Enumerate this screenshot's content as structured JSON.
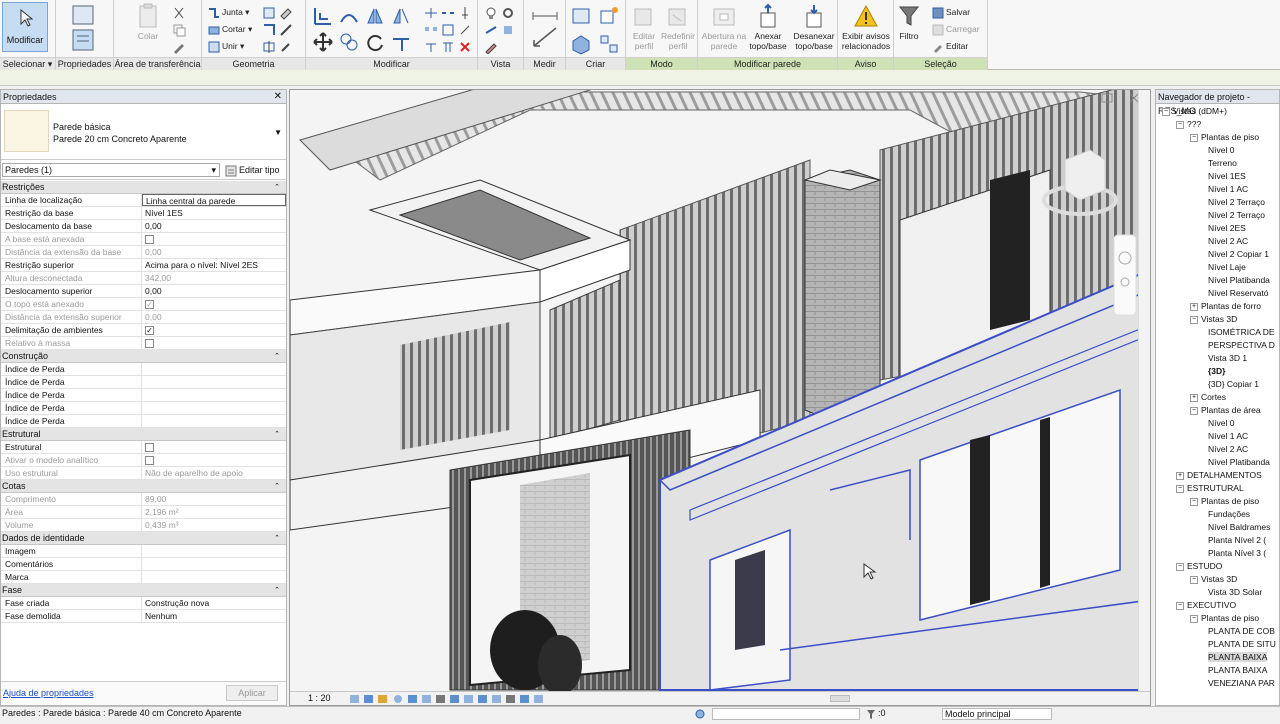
{
  "ribbon": {
    "select_panel": {
      "big_label": "Modificar",
      "label": "Selecionar ▾"
    },
    "properties_panel": {
      "label": "Propriedades"
    },
    "clipboard_panel": {
      "color_label": "Colar",
      "label": "Área de transferência"
    },
    "geometry_panel": {
      "join_label": "Junta",
      "cut_label": "Cortar",
      "unite_label": "Unir",
      "label": "Geometria"
    },
    "modify_panel": {
      "label": "Modificar"
    },
    "view_panel": {
      "label": "Vista"
    },
    "measure_panel": {
      "label": "Medir"
    },
    "create_panel": {
      "label": "Criar"
    },
    "mode_panel": {
      "edit_profile": "Editar perfil",
      "reset_profile": "Redefinir perfil",
      "label": "Modo"
    },
    "modify_wall_panel": {
      "wall_opening": "Abertura na parede",
      "attach": "Anexar topo/base",
      "detach": "Desanexar topo/base",
      "label": "Modificar parede"
    },
    "warning_panel": {
      "show_warnings": "Exibir avisos relacionados",
      "label": "Aviso"
    },
    "selection_panel": {
      "filter": "Filtro",
      "save": "Salvar",
      "load": "Carregar",
      "edit": "Editar",
      "label": "Seleção"
    }
  },
  "properties": {
    "title": "Propriedades",
    "type_family": "Parede básica",
    "type_name": "Parede 20 cm Concreto Aparente",
    "instance_filter": "Paredes (1)",
    "edit_type": "Editar tipo",
    "groups": [
      {
        "name": "Restrições",
        "rows": [
          {
            "k": "Linha de localização",
            "v": "Linha central da parede",
            "dim": false,
            "boxed": true
          },
          {
            "k": "Restrição da base",
            "v": "Nível 1ES",
            "dim": false
          },
          {
            "k": "Deslocamento da base",
            "v": "0,00",
            "dim": false
          },
          {
            "k": "A base está anexada",
            "v": "",
            "cb": "off",
            "dim": true
          },
          {
            "k": "Distância da extensão da base",
            "v": "0,00",
            "dim": true
          },
          {
            "k": "Restrição superior",
            "v": "Acima para o nível: Nível 2ES",
            "dim": false
          },
          {
            "k": "Altura desconectada",
            "v": "342,00",
            "dim": true
          },
          {
            "k": "Deslocamento superior",
            "v": "0,00",
            "dim": false
          },
          {
            "k": "O topo está anexado",
            "v": "",
            "cb": "on",
            "dim": true
          },
          {
            "k": "Distância da extensão superior",
            "v": "0,00",
            "dim": true
          },
          {
            "k": "Delimitação de ambientes",
            "v": "",
            "cb": "on",
            "dim": false
          },
          {
            "k": "Relativo à massa",
            "v": "",
            "cb": "off",
            "dim": true
          }
        ]
      },
      {
        "name": "Construção",
        "rows": [
          {
            "k": "Índice de Perda",
            "v": ""
          },
          {
            "k": "Índice de Perda",
            "v": ""
          },
          {
            "k": "Índice de Perda",
            "v": ""
          },
          {
            "k": "Índice de Perda",
            "v": ""
          },
          {
            "k": "Índice de Perda",
            "v": ""
          }
        ]
      },
      {
        "name": "Estrutural",
        "rows": [
          {
            "k": "Estrutural",
            "v": "",
            "cb": "off",
            "dim": false
          },
          {
            "k": "Ativar o modelo analítico",
            "v": "",
            "cb": "off",
            "dim": true
          },
          {
            "k": "Uso estrutural",
            "v": "Não de aparelho de apoio",
            "dim": true
          }
        ]
      },
      {
        "name": "Cotas",
        "rows": [
          {
            "k": "Comprimento",
            "v": "89,00",
            "dim": true
          },
          {
            "k": "Área",
            "v": "2,196 m²",
            "dim": true
          },
          {
            "k": "Volume",
            "v": "0,439 m³",
            "dim": true
          }
        ]
      },
      {
        "name": "Dados de identidade",
        "rows": [
          {
            "k": "Imagem",
            "v": ""
          },
          {
            "k": "Comentários",
            "v": ""
          },
          {
            "k": "Marca",
            "v": ""
          }
        ]
      },
      {
        "name": "Fase",
        "rows": [
          {
            "k": "Fase criada",
            "v": "Construção nova"
          },
          {
            "k": "Fase demolida",
            "v": "Nenhum"
          }
        ]
      }
    ],
    "help_link": "Ajuda de propriedades",
    "apply": "Aplicar"
  },
  "view": {
    "scale": "1 : 20"
  },
  "browser": {
    "title": "Navegador de projeto - RES_MO",
    "items": [
      {
        "label": "Vistas (dDM+)",
        "indent": 0,
        "tg": "−"
      },
      {
        "label": "???",
        "indent": 1,
        "tg": "−"
      },
      {
        "label": "Plantas de piso",
        "indent": 2,
        "tg": "−"
      },
      {
        "label": "Nível 0",
        "indent": 3
      },
      {
        "label": "Terreno",
        "indent": 3
      },
      {
        "label": "Nível 1ES",
        "indent": 3
      },
      {
        "label": "Nível 1 AC",
        "indent": 3
      },
      {
        "label": "Nível 2 Terraço",
        "indent": 3
      },
      {
        "label": "Nível 2 Terraço",
        "indent": 3
      },
      {
        "label": "Nível 2ES",
        "indent": 3
      },
      {
        "label": "Nível 2 AC",
        "indent": 3
      },
      {
        "label": "Nível 2 Copiar 1",
        "indent": 3
      },
      {
        "label": "Nível Laje",
        "indent": 3
      },
      {
        "label": "Nível Platibanda",
        "indent": 3
      },
      {
        "label": "Nível Reservató",
        "indent": 3
      },
      {
        "label": "Plantas de forro",
        "indent": 2,
        "tg": "+"
      },
      {
        "label": "Vistas 3D",
        "indent": 2,
        "tg": "−"
      },
      {
        "label": "ISOMÉTRICA DE",
        "indent": 3
      },
      {
        "label": "PERSPECTIVA D",
        "indent": 3
      },
      {
        "label": "Vista 3D 1",
        "indent": 3
      },
      {
        "label": "{3D}",
        "indent": 3,
        "bold": true
      },
      {
        "label": "{3D} Copiar 1",
        "indent": 3
      },
      {
        "label": "Cortes",
        "indent": 2,
        "tg": "+"
      },
      {
        "label": "Plantas de área",
        "indent": 2,
        "tg": "−"
      },
      {
        "label": "Nível 0",
        "indent": 3
      },
      {
        "label": "Nível 1 AC",
        "indent": 3
      },
      {
        "label": "Nível 2 AC",
        "indent": 3
      },
      {
        "label": "Nível Platibanda",
        "indent": 3
      },
      {
        "label": "DETALHAMENTOS",
        "indent": 1,
        "tg": "+"
      },
      {
        "label": "ESTRUTURAL",
        "indent": 1,
        "tg": "−"
      },
      {
        "label": "Plantas de piso",
        "indent": 2,
        "tg": "−"
      },
      {
        "label": "Fundações",
        "indent": 3
      },
      {
        "label": "Nível Baldrames",
        "indent": 3
      },
      {
        "label": "Planta Nível 2 (",
        "indent": 3
      },
      {
        "label": "Planta Nível 3 (",
        "indent": 3
      },
      {
        "label": "ESTUDO",
        "indent": 1,
        "tg": "−"
      },
      {
        "label": "Vistas 3D",
        "indent": 2,
        "tg": "−"
      },
      {
        "label": "Vista 3D Solar",
        "indent": 3
      },
      {
        "label": "EXECUTIVO",
        "indent": 1,
        "tg": "−"
      },
      {
        "label": "Plantas de piso",
        "indent": 2,
        "tg": "−"
      },
      {
        "label": "PLANTA DE COB",
        "indent": 3
      },
      {
        "label": "PLANTA DE SITU",
        "indent": 3
      },
      {
        "label": "PLANTA BAIXA",
        "indent": 3,
        "hl": true
      },
      {
        "label": "PLANTA BAIXA",
        "indent": 3
      },
      {
        "label": "VENEZIANA PAR",
        "indent": 3
      }
    ]
  },
  "status": {
    "text": "Paredes : Parede básica : Parede 40 cm Concreto Aparente",
    "zero": ":0",
    "model": "Modelo principal"
  },
  "colors": {
    "accent": "#c6dcf2",
    "highlight_wall": "#3a4fc8",
    "ribbon_context": "#cfe2b5"
  }
}
